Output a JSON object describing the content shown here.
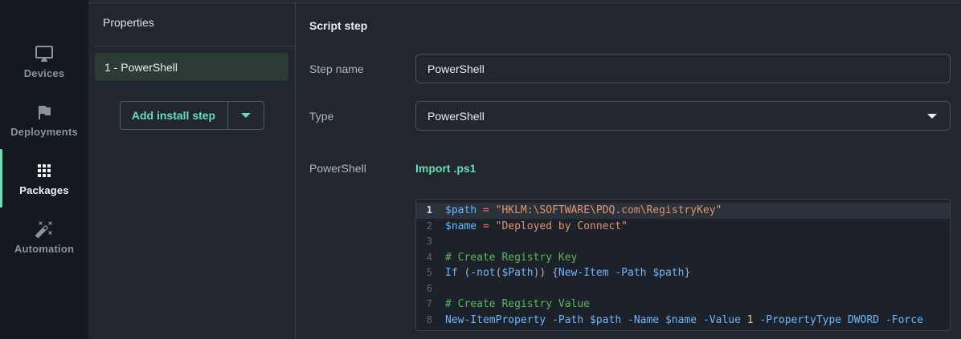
{
  "colors": {
    "accent_mint": "#63dfb2",
    "sidebar_bg": "#14181f",
    "panel_bg": "#22272f",
    "editor_bg": "#1d2129",
    "active_line_bg": "#2c323c",
    "selected_step_bg": "#2d3b36",
    "divider": "#3a414b",
    "field_border": "#4a525d",
    "syntax_variable": "#6cb6ff",
    "syntax_string": "#e0936e",
    "syntax_comment": "#5cb55c",
    "syntax_operator": "#f47067",
    "syntax_number": "#ccd17c"
  },
  "sidebar": {
    "items": [
      {
        "label": "Devices",
        "icon": "devices-icon",
        "active": false
      },
      {
        "label": "Deployments",
        "icon": "deployments-icon",
        "active": false
      },
      {
        "label": "Packages",
        "icon": "packages-icon",
        "active": true
      },
      {
        "label": "Automation",
        "icon": "automation-icon",
        "active": false
      }
    ]
  },
  "properties": {
    "title": "Properties",
    "steps": [
      {
        "label": "1 - PowerShell"
      }
    ],
    "add_button": "Add install step"
  },
  "main": {
    "title": "Script step",
    "step_name": {
      "label": "Step name",
      "value": "PowerShell"
    },
    "type": {
      "label": "Type",
      "value": "PowerShell"
    },
    "script": {
      "label": "PowerShell",
      "import_link": "Import .ps1"
    },
    "editor": {
      "lines": [
        {
          "num": "1",
          "active": true,
          "tokens": [
            {
              "t": "v",
              "v": "$path"
            },
            {
              "t": "p",
              "v": " "
            },
            {
              "t": "o",
              "v": "="
            },
            {
              "t": "p",
              "v": " "
            },
            {
              "t": "s",
              "v": "\"HKLM:\\SOFTWARE\\PDQ.com\\RegistryKey\""
            }
          ]
        },
        {
          "num": "2",
          "active": false,
          "tokens": [
            {
              "t": "v",
              "v": "$name"
            },
            {
              "t": "p",
              "v": " "
            },
            {
              "t": "o",
              "v": "="
            },
            {
              "t": "p",
              "v": " "
            },
            {
              "t": "s",
              "v": "\"Deployed by Connect\""
            }
          ]
        },
        {
          "num": "3",
          "active": false,
          "tokens": []
        },
        {
          "num": "4",
          "active": false,
          "tokens": [
            {
              "t": "c",
              "v": "# Create Registry Key"
            }
          ]
        },
        {
          "num": "5",
          "active": false,
          "tokens": [
            {
              "t": "v",
              "v": "If"
            },
            {
              "t": "p",
              "v": " ("
            },
            {
              "t": "v",
              "v": "-not"
            },
            {
              "t": "p",
              "v": "("
            },
            {
              "t": "v",
              "v": "$Path"
            },
            {
              "t": "p",
              "v": ")) {"
            },
            {
              "t": "v",
              "v": "New-Item"
            },
            {
              "t": "p",
              "v": " "
            },
            {
              "t": "v",
              "v": "-Path"
            },
            {
              "t": "p",
              "v": " "
            },
            {
              "t": "v",
              "v": "$path"
            },
            {
              "t": "p",
              "v": "}"
            }
          ]
        },
        {
          "num": "6",
          "active": false,
          "tokens": []
        },
        {
          "num": "7",
          "active": false,
          "tokens": [
            {
              "t": "c",
              "v": "# Create Registry Value"
            }
          ]
        },
        {
          "num": "8",
          "active": false,
          "tokens": [
            {
              "t": "v",
              "v": "New-ItemProperty"
            },
            {
              "t": "p",
              "v": " "
            },
            {
              "t": "v",
              "v": "-Path"
            },
            {
              "t": "p",
              "v": " "
            },
            {
              "t": "v",
              "v": "$path"
            },
            {
              "t": "p",
              "v": " "
            },
            {
              "t": "v",
              "v": "-Name"
            },
            {
              "t": "p",
              "v": " "
            },
            {
              "t": "v",
              "v": "$name"
            },
            {
              "t": "p",
              "v": " "
            },
            {
              "t": "v",
              "v": "-Value"
            },
            {
              "t": "p",
              "v": " "
            },
            {
              "t": "n",
              "v": "1"
            },
            {
              "t": "p",
              "v": " "
            },
            {
              "t": "v",
              "v": "-PropertyType"
            },
            {
              "t": "p",
              "v": " "
            },
            {
              "t": "v",
              "v": "DWORD"
            },
            {
              "t": "p",
              "v": " "
            },
            {
              "t": "v",
              "v": "-Force"
            }
          ]
        }
      ]
    }
  }
}
